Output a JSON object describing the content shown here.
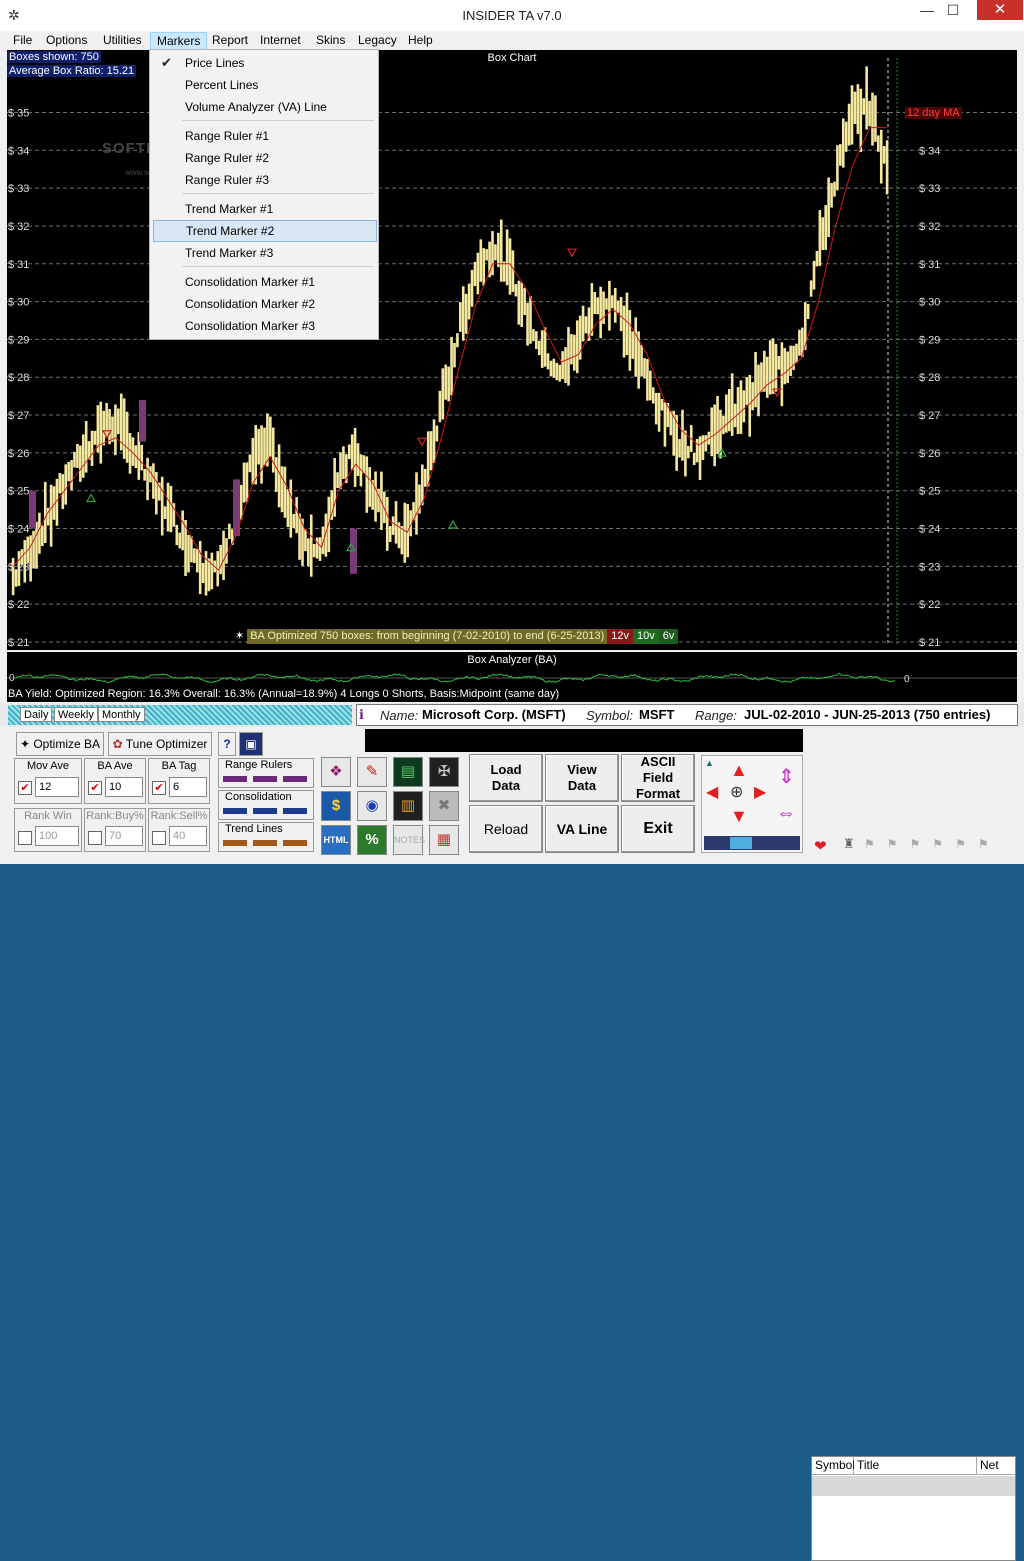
{
  "window": {
    "title": "INSIDER TA v7.0",
    "minimize": "—",
    "maximize": "☐",
    "close": "✕"
  },
  "menu": [
    "File",
    "Options",
    "Utilities",
    "Markers",
    "Report",
    "Internet",
    "Skins",
    "Legacy",
    "Help"
  ],
  "markers_menu": {
    "items": [
      {
        "label": "Price Lines",
        "checked": true
      },
      {
        "label": "Percent Lines"
      },
      {
        "label": "Volume Analyzer (VA) Line"
      },
      {
        "label": "Range Ruler #1"
      },
      {
        "label": "Range Ruler #2"
      },
      {
        "label": "Range Ruler #3"
      },
      {
        "label": "Trend Marker #1"
      },
      {
        "label": "Trend Marker #2",
        "highlighted": true
      },
      {
        "label": "Trend Marker #3"
      },
      {
        "label": "Consolidation Marker #1"
      },
      {
        "label": "Consolidation Marker #2"
      },
      {
        "label": "Consolidation Marker #3"
      }
    ]
  },
  "chart": {
    "title": "Box Chart",
    "boxes_shown": "Boxes shown: 750",
    "avg_ratio": "Average Box Ratio: 15.21",
    "ma_label": "12 day MA",
    "watermark": "SOFTPEDIA",
    "watermark_sub": "www.softpedia.com",
    "ba_status": "BA Optimized 750 boxes: from beginning (7-02-2010) to end (6-25-2013)",
    "tags": [
      "12v",
      "10v",
      "6v"
    ],
    "colors": {
      "bars": "#f5e9a0",
      "ma": "#d01818",
      "grid": "#707070",
      "buy": "#2aa63a",
      "sell": "#d22020",
      "tag12": "#8a1a1a",
      "tag10": "#1d6b1d",
      "tag6": "#1d5a1d"
    }
  },
  "chart_data": {
    "type": "line",
    "title": "Box Chart",
    "ylabel": "",
    "ylim": [
      21,
      35.7
    ],
    "y_ticks": [
      "$ 21",
      "$ 22",
      "$ 23",
      "$ 24",
      "$ 25",
      "$ 26",
      "$ 27",
      "$ 28",
      "$ 29",
      "$ 30",
      "$ 31",
      "$ 32",
      "$ 33",
      "$ 34",
      "$ 35"
    ],
    "grid": true,
    "series": [
      {
        "name": "12 day MA",
        "values": [
          23.0,
          23.5,
          24.4,
          25.0,
          25.6,
          26.2,
          26.4,
          26.0,
          25.5,
          24.8,
          24.1,
          23.3,
          22.9,
          23.8,
          25.2,
          25.9,
          25.1,
          24.0,
          23.5,
          25.0,
          25.7,
          25.2,
          24.2,
          23.9,
          24.8,
          26.4,
          28.2,
          29.9,
          31.0,
          31.0,
          30.3,
          29.3,
          28.4,
          28.6,
          29.4,
          29.8,
          29.4,
          28.6,
          27.4,
          26.6,
          26.2,
          26.5,
          26.9,
          27.3,
          27.8,
          28.1,
          28.5,
          30.0,
          32.0,
          33.6,
          34.6,
          34.6
        ]
      },
      {
        "name": "Box Chart",
        "values": [
          22.7,
          23.4,
          24.3,
          25.2,
          25.9,
          26.6,
          26.8,
          26.1,
          25.2,
          24.5,
          23.7,
          23.1,
          22.8,
          24.3,
          25.8,
          26.2,
          24.6,
          23.7,
          23.3,
          25.6,
          26.1,
          25.0,
          24.0,
          23.8,
          25.3,
          27.2,
          29.2,
          30.8,
          31.5,
          30.8,
          29.6,
          28.6,
          28.1,
          29.0,
          29.9,
          30.0,
          29.1,
          27.9,
          26.9,
          26.3,
          26.0,
          26.6,
          27.1,
          27.5,
          28.1,
          28.3,
          29.0,
          31.3,
          33.3,
          34.9,
          35.2,
          33.4
        ]
      }
    ]
  },
  "analyzer": {
    "title": "Box Analyzer (BA)",
    "zero_left": "0",
    "zero_right": "0",
    "yield_text": "BA Yield: Optimized Region: 16.3% Overall: 16.3% (Annual=18.9%) 4 Longs 0 Shorts, Basis:Midpoint (same day)"
  },
  "tabs": [
    "Daily",
    "Weekly",
    "Monthly"
  ],
  "info": {
    "name_label": "Name:",
    "name_value": "Microsoft Corp. (MSFT)",
    "symbol_label": "Symbol:",
    "symbol_value": "MSFT",
    "range_label": "Range:",
    "range_value": "JUL-02-2010 - JUN-25-2013 (750 entries)"
  },
  "controls": {
    "optimize_ba": "Optimize BA",
    "tune_optimizer": "Tune Optimizer",
    "help": "?",
    "mov_ave_label": "Mov Ave",
    "mov_ave": "12",
    "ba_ave_label": "BA Ave",
    "ba_ave": "10",
    "ba_tag_label": "BA Tag",
    "ba_tag": "6",
    "rank_win_label": "Rank Win",
    "rank_win": "100",
    "rank_buy_label": "Rank:Buy%",
    "rank_buy": "70",
    "rank_sell_label": "Rank:Sell%",
    "rank_sell": "40",
    "range_rulers": "Range Rulers",
    "consolidation": "Consolidation",
    "trend_lines": "Trend Lines",
    "load_data": "Load Data",
    "view_data": "View Data",
    "ascii": "ASCII Field Format",
    "reload": "Reload",
    "va_line": "VA Line",
    "exit": "Exit"
  },
  "list": {
    "headers": [
      "Symbol",
      "Title",
      "Net"
    ]
  }
}
